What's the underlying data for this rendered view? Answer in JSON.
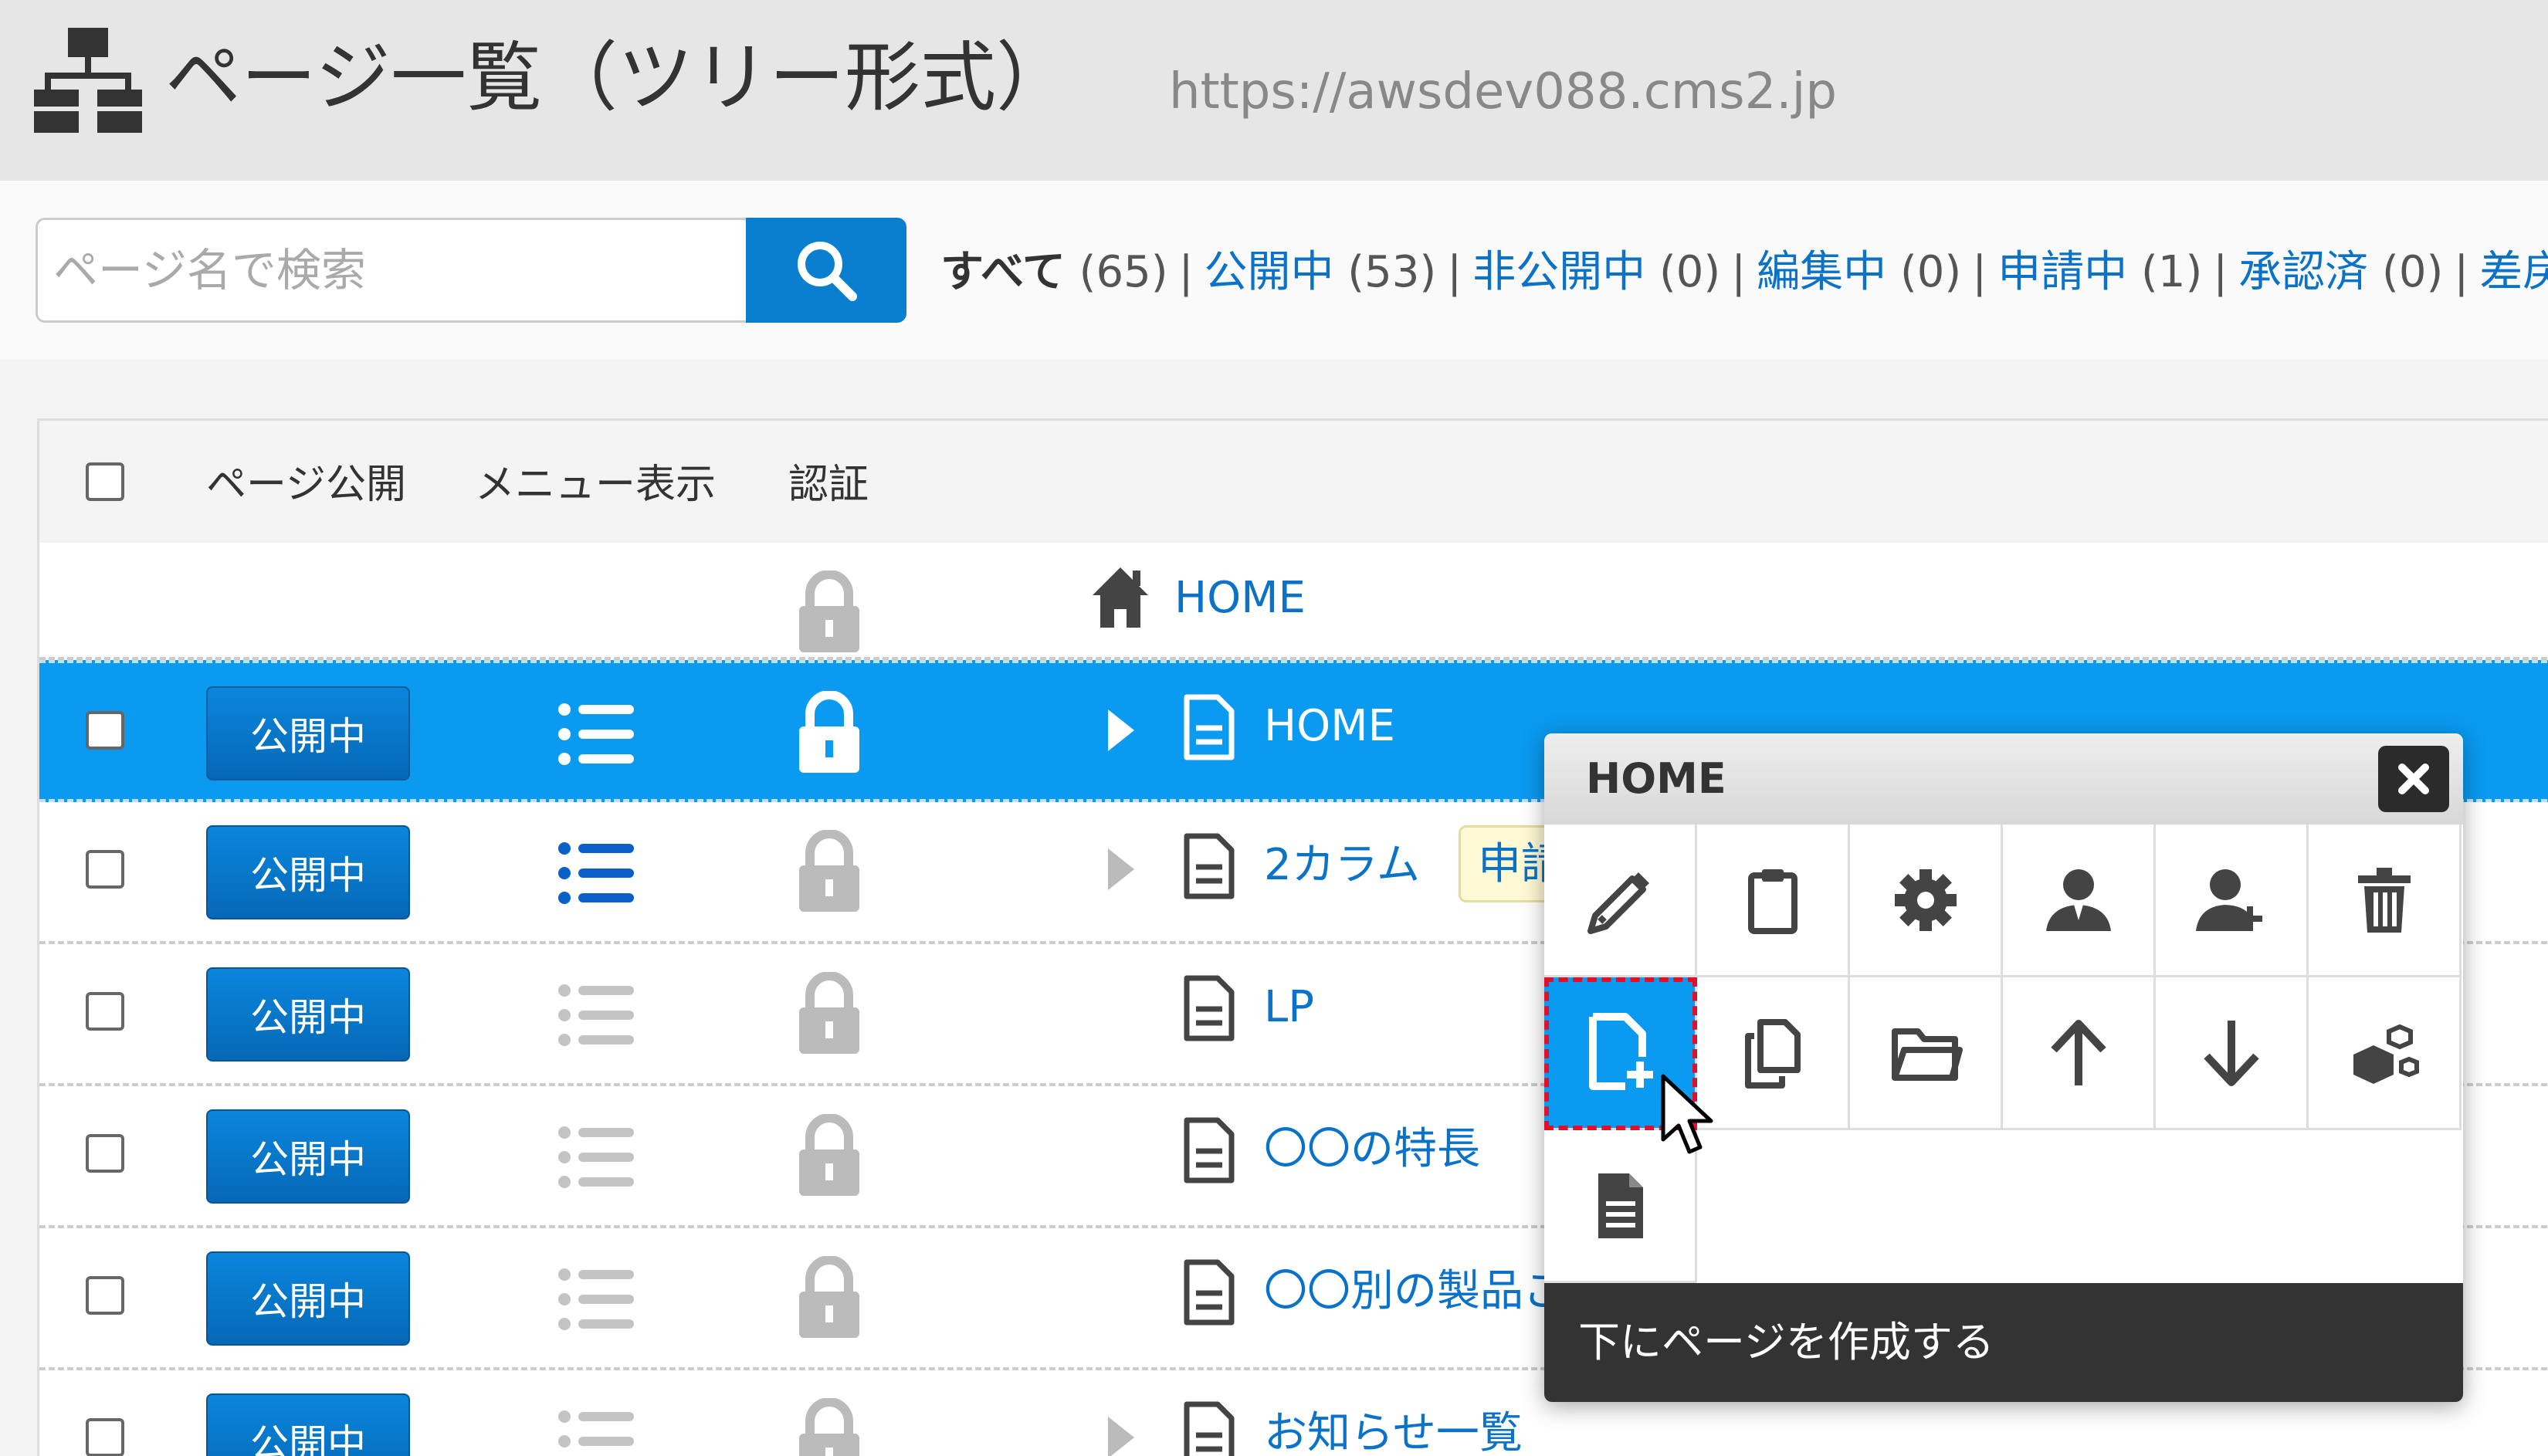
{
  "header": {
    "title": "ページ一覧（ツリー形式）",
    "url": "https://awsdev088.cms2.jp"
  },
  "search": {
    "placeholder": "ページ名で検索",
    "value": ""
  },
  "filters": [
    {
      "label": "すべて",
      "count": "(65)",
      "active": true
    },
    {
      "label": "公開中",
      "count": "(53)",
      "active": false
    },
    {
      "label": "非公開中",
      "count": "(0)",
      "active": false
    },
    {
      "label": "編集中",
      "count": "(0)",
      "active": false
    },
    {
      "label": "申請中",
      "count": "(1)",
      "active": false
    },
    {
      "label": "承認済",
      "count": "(0)",
      "active": false
    },
    {
      "label": "差戻",
      "count": "",
      "active": false
    }
  ],
  "table": {
    "columns": {
      "publish": "ページ公開",
      "menu": "メニュー表示",
      "auth": "認証"
    },
    "root": {
      "name": "HOME"
    },
    "rows": [
      {
        "name": "HOME",
        "status": "公開中",
        "expandable": true,
        "menu_active": true,
        "selected": true,
        "badge": ""
      },
      {
        "name": "2カラム",
        "status": "公開中",
        "expandable": true,
        "menu_active": true,
        "selected": false,
        "badge": "申請中"
      },
      {
        "name": "LP",
        "status": "公開中",
        "expandable": false,
        "menu_active": false,
        "selected": false,
        "badge": ""
      },
      {
        "name": "〇〇の特長",
        "status": "公開中",
        "expandable": false,
        "menu_active": false,
        "selected": false,
        "badge": ""
      },
      {
        "name": "〇〇別の製品ご",
        "status": "公開中",
        "expandable": false,
        "menu_active": false,
        "selected": false,
        "badge": ""
      },
      {
        "name": "お知らせ一覧",
        "status": "公開中",
        "expandable": true,
        "menu_active": false,
        "selected": false,
        "badge": ""
      }
    ]
  },
  "popup": {
    "title": "HOME",
    "actions": [
      {
        "icon": "pencil-icon",
        "name": "edit"
      },
      {
        "icon": "clipboard-icon",
        "name": "clipboard"
      },
      {
        "icon": "gear-icon",
        "name": "settings"
      },
      {
        "icon": "user-icon",
        "name": "user"
      },
      {
        "icon": "user-add-icon",
        "name": "add-user"
      },
      {
        "icon": "trash-icon",
        "name": "delete"
      },
      {
        "icon": "page-add-icon",
        "name": "create-page-below"
      },
      {
        "icon": "copy-icon",
        "name": "copy"
      },
      {
        "icon": "folder-icon",
        "name": "move-folder"
      },
      {
        "icon": "arrow-up-icon",
        "name": "move-up"
      },
      {
        "icon": "arrow-down-icon",
        "name": "move-down"
      },
      {
        "icon": "cubes-icon",
        "name": "parts"
      },
      {
        "icon": "document-icon",
        "name": "document"
      }
    ],
    "tooltip": "下にページを作成する"
  },
  "colors": {
    "accent": "#0a9af0",
    "button": "#0a7fd0",
    "link": "#0a72c8",
    "highlight_border": "#e0102a"
  }
}
